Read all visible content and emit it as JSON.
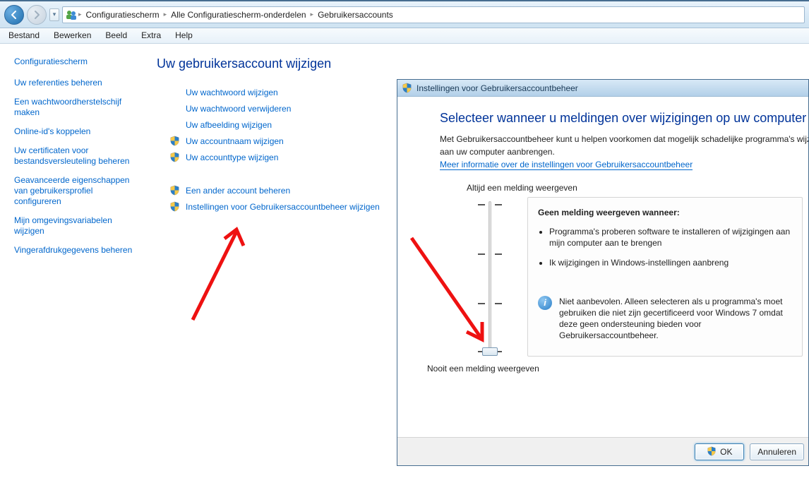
{
  "breadcrumbs": [
    "Configuratiescherm",
    "Alle Configuratiescherm-onderdelen",
    "Gebruikersaccounts"
  ],
  "menu": [
    "Bestand",
    "Bewerken",
    "Beeld",
    "Extra",
    "Help"
  ],
  "sidebar": {
    "title": "Configuratiescherm",
    "links": [
      "Uw referenties beheren",
      "Een wachtwoordherstelschijf maken",
      "Online-id's koppelen",
      "Uw certificaten voor bestandsversleuteling beheren",
      "Geavanceerde eigenschappen van gebruikersprofiel configureren",
      "Mijn omgevingsvariabelen wijzigen",
      "Vingerafdrukgegevens beheren"
    ]
  },
  "center": {
    "heading": "Uw gebruikersaccount wijzigen",
    "actions": [
      {
        "label": "Uw wachtwoord wijzigen",
        "shield": false
      },
      {
        "label": "Uw wachtwoord verwijderen",
        "shield": false
      },
      {
        "label": "Uw afbeelding wijzigen",
        "shield": false
      },
      {
        "label": "Uw accountnaam wijzigen",
        "shield": true
      },
      {
        "label": "Uw accounttype wijzigen",
        "shield": true
      }
    ],
    "actions2": [
      {
        "label": "Een ander account beheren",
        "shield": true
      },
      {
        "label": "Instellingen voor Gebruikersaccountbeheer wijzigen",
        "shield": true
      }
    ]
  },
  "uac": {
    "title": "Instellingen voor Gebruikersaccountbeheer",
    "heading": "Selecteer wanneer u meldingen over wijzigingen op uw computer wilt ontvangen",
    "para1": "Met Gebruikersaccountbeheer kunt u helpen voorkomen dat mogelijk schadelijke programma's wijzigingen",
    "para2": "aan uw computer aanbrengen.",
    "link": "Meer informatie over de instellingen voor Gebruikersaccountbeheer",
    "top_label": "Altijd een melding weergeven",
    "bottom_label": "Nooit een melding weergeven",
    "panel_heading": "Geen melding weergeven wanneer:",
    "bullets": [
      "Programma's proberen software te installeren of wijzigingen aan mijn computer aan te brengen",
      "Ik wijzigingen in Windows-instellingen aanbreng"
    ],
    "warn": "Niet aanbevolen. Alleen selecteren als u programma's moet gebruiken die niet zijn gecertificeerd voor Windows 7 omdat deze geen ondersteuning bieden voor Gebruikersaccountbeheer.",
    "ok": "OK",
    "cancel": "Annuleren"
  }
}
